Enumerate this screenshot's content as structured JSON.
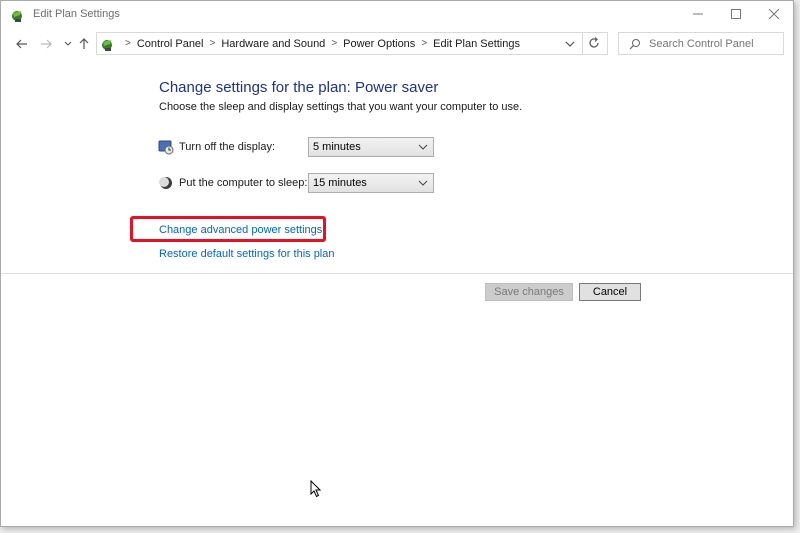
{
  "window": {
    "title": "Edit Plan Settings"
  },
  "title_controls": {
    "minimize": "—",
    "maximize": "☐",
    "close": "✕"
  },
  "nav": {
    "breadcrumbs": [
      "Control Panel",
      "Hardware and Sound",
      "Power Options",
      "Edit Plan Settings"
    ],
    "search_placeholder": "Search Control Panel"
  },
  "content": {
    "heading": "Change settings for the plan: Power saver",
    "subtext": "Choose the sleep and display settings that you want your computer to use.",
    "display_label": "Turn off the display:",
    "display_value": "5 minutes",
    "sleep_label": "Put the computer to sleep:",
    "sleep_value": "15 minutes",
    "advanced_link": "Change advanced power settings",
    "restore_link": "Restore default settings for this plan"
  },
  "buttons": {
    "save": "Save changes",
    "cancel": "Cancel"
  },
  "colors": {
    "heading": "#1e3287",
    "link": "#0066cc",
    "highlight": "#e81123"
  }
}
